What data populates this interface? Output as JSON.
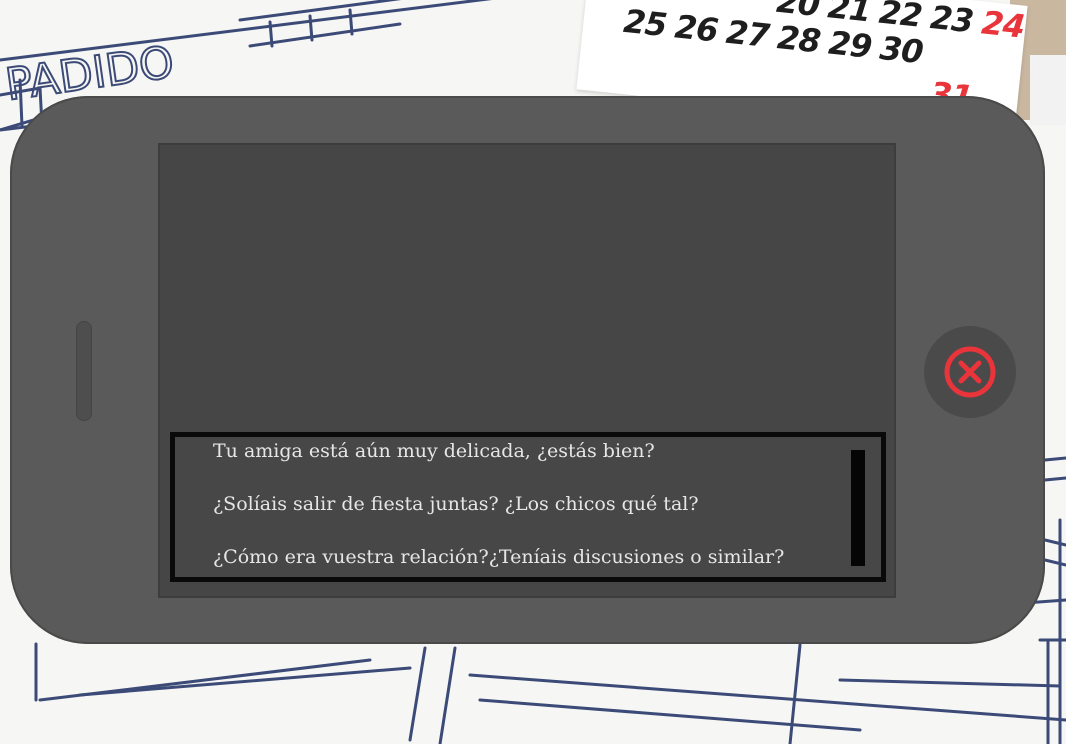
{
  "background": {
    "sketch_text": "PADIDO",
    "calendar": {
      "row_top": [
        "20",
        "21",
        "22",
        "23",
        "24"
      ],
      "row_middle": [
        "25",
        "26",
        "27",
        "28",
        "29",
        "30"
      ],
      "row_bottom_highlight": "31",
      "red_days": [
        "24",
        "31"
      ],
      "accent_color": "#e8343a"
    }
  },
  "phone": {
    "body_color": "#5a5a5a",
    "screen_color": "#464646",
    "close_button": {
      "icon": "close-circle-icon",
      "color": "#e8343a"
    }
  },
  "dialog": {
    "options": [
      {
        "text": "Tu amiga está aún muy delicada, ¿estás bien?"
      },
      {
        "text": "¿Solíais salir de fiesta juntas? ¿Los chicos qué tal?"
      },
      {
        "text": "¿Cómo era vuestra relación?¿Teníais discusiones o similar?"
      }
    ]
  }
}
